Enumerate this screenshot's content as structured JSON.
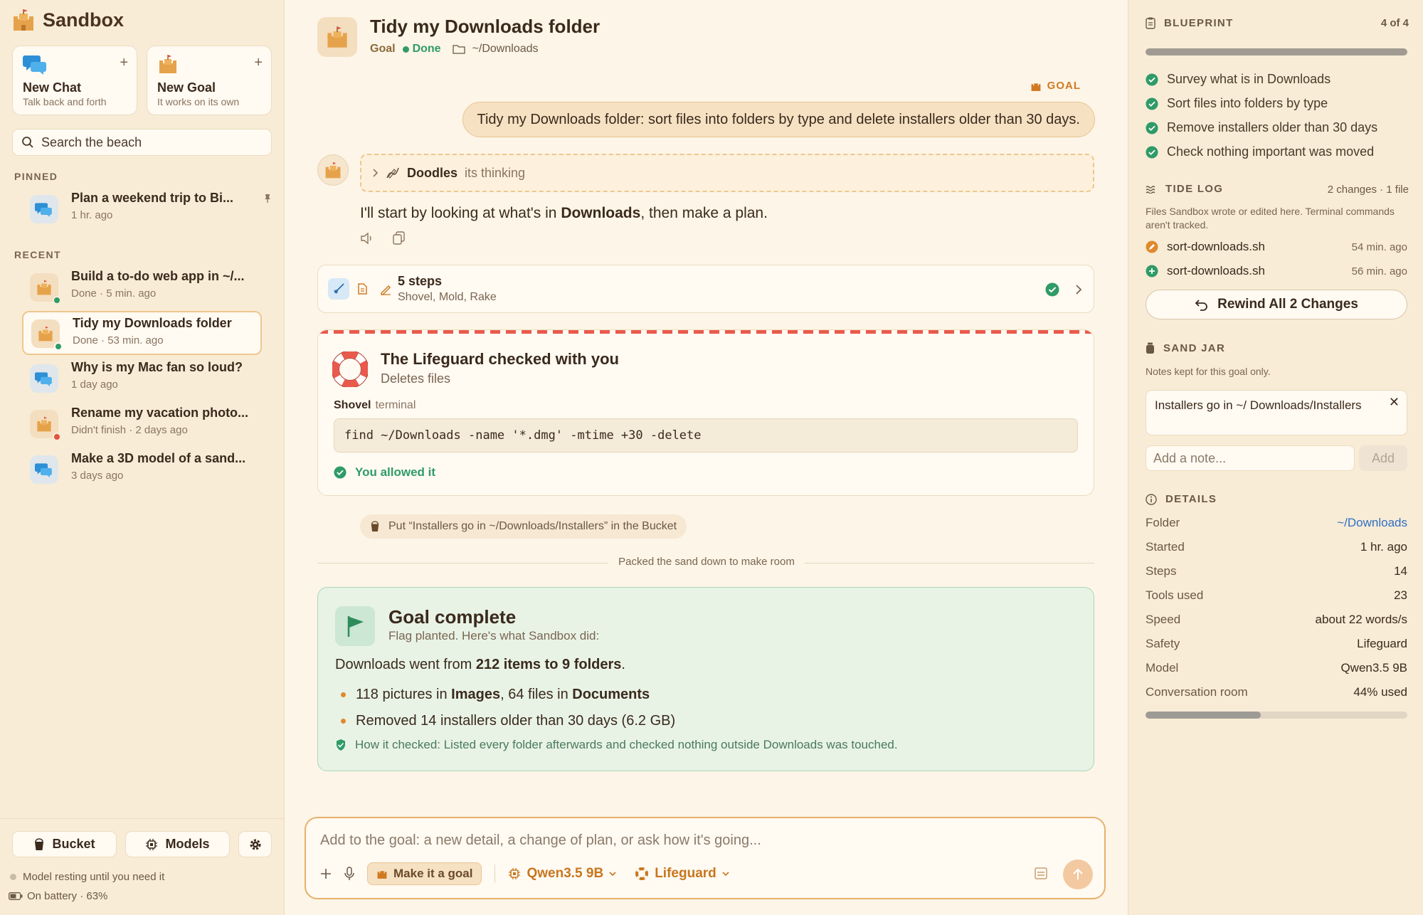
{
  "app": {
    "name": "Sandbox"
  },
  "sidebar": {
    "new_chat": {
      "title": "New Chat",
      "subtitle": "Talk back and forth"
    },
    "new_goal": {
      "title": "New Goal",
      "subtitle": "It works on its own"
    },
    "search": {
      "placeholder": "Search the beach"
    },
    "pinned_label": "PINNED",
    "recent_label": "RECENT",
    "pinned": [
      {
        "title": "Plan a weekend trip to Bi...",
        "meta": "1 hr. ago",
        "kind": "chat",
        "pinned_icon": "pin-icon"
      }
    ],
    "recent": [
      {
        "title": "Build a to-do web app in ~/...",
        "meta": "Done · 5 min. ago",
        "kind": "goal",
        "status": "done"
      },
      {
        "title": "Tidy my Downloads folder",
        "meta": "Done · 53 min. ago",
        "kind": "goal",
        "status": "done",
        "selected": true
      },
      {
        "title": "Why is my Mac fan so loud?",
        "meta": "1 day ago",
        "kind": "chat"
      },
      {
        "title": "Rename my vacation photo...",
        "meta": "Didn't finish · 2 days ago",
        "kind": "goal",
        "status": "failed"
      },
      {
        "title": "Make a 3D model of a sand...",
        "meta": "3 days ago",
        "kind": "chat"
      }
    ],
    "footer": {
      "bucket": "Bucket",
      "models": "Models",
      "model_status": "Model resting until you need it",
      "battery": "On battery · 63%"
    }
  },
  "header": {
    "title": "Tidy my Downloads folder",
    "kind": "Goal",
    "status": "Done",
    "folder": "~/Downloads"
  },
  "conversation": {
    "goal_tag": "GOAL",
    "user_message": "Tidy my Downloads folder: sort files into folders by type and delete installers older than 30 days.",
    "thinking": {
      "name": "Doodles",
      "status": "its thinking"
    },
    "reply": {
      "before": "I'll start by looking at what's in ",
      "bold": "Downloads",
      "after": ", then make a plan."
    },
    "steps": {
      "title": "5 steps",
      "tools": "Shovel, Mold, Rake"
    },
    "lifeguard": {
      "title": "The Lifeguard checked with you",
      "subtitle": "Deletes files",
      "tool": "Shovel",
      "tool_kind": "terminal",
      "command": "find ~/Downloads -name '*.dmg' -mtime +30 -delete",
      "result": "You allowed it"
    },
    "bucket_note": "Put “Installers go in ~/Downloads/Installers” in the Bucket",
    "divider": "Packed the sand down to make room",
    "complete": {
      "title": "Goal complete",
      "subtitle": "Flag planted. Here's what Sandbox did:",
      "lead": {
        "before": "Downloads went from ",
        "bold": "212 items to 9 folders",
        "after": "."
      },
      "bullets": [
        {
          "p1": "118 pictures in ",
          "b1": "Images",
          "p2": ", 64 files in ",
          "b2": "Documents"
        },
        {
          "p1": "Removed 14 installers older than 30 days (6.2 GB)",
          "b1": "",
          "p2": "",
          "b2": ""
        }
      ],
      "check": "How it checked: Listed every folder afterwards and checked nothing outside Downloads was touched."
    }
  },
  "composer": {
    "placeholder": "Add to the goal: a new detail, a change of plan, or ask how it's going...",
    "make_goal": "Make it a goal",
    "model": "Qwen3.5 9B",
    "safety": "Lifeguard"
  },
  "right": {
    "blueprint": {
      "label": "BLUEPRINT",
      "count": "4 of 4",
      "progress": 1.0,
      "items": [
        "Survey what is in Downloads",
        "Sort files into folders by type",
        "Remove installers older than 30 days",
        "Check nothing important was moved"
      ]
    },
    "tide_log": {
      "label": "TIDE LOG",
      "summary": "2 changes · 1 file",
      "note": "Files Sandbox wrote or edited here. Terminal commands aren't tracked.",
      "entries": [
        {
          "file": "sort-downloads.sh",
          "time": "54 min. ago",
          "change": "edited"
        },
        {
          "file": "sort-downloads.sh",
          "time": "56 min. ago",
          "change": "created"
        }
      ],
      "rewind": "Rewind All 2 Changes"
    },
    "sand_jar": {
      "label": "SAND JAR",
      "note": "Notes kept for this goal only.",
      "entries": [
        "Installers go in ~/ Downloads/Installers"
      ],
      "input_placeholder": "Add a note...",
      "add": "Add"
    },
    "details": {
      "label": "DETAILS",
      "rows": [
        {
          "k": "Folder",
          "v": "~/Downloads"
        },
        {
          "k": "Started",
          "v": "1 hr. ago"
        },
        {
          "k": "Steps",
          "v": "14"
        },
        {
          "k": "Tools used",
          "v": "23"
        },
        {
          "k": "Speed",
          "v": "about 22 words/s"
        },
        {
          "k": "Safety",
          "v": "Lifeguard"
        },
        {
          "k": "Model",
          "v": "Qwen3.5 9B"
        },
        {
          "k": "Conversation room",
          "v": "44% used"
        }
      ],
      "room_used": 0.44
    }
  },
  "colors": {
    "accent": "#cf7a22",
    "success": "#2f9b67",
    "danger": "#e05243",
    "link": "#2f6ec4",
    "chat_blue": "#2d8fd6"
  }
}
